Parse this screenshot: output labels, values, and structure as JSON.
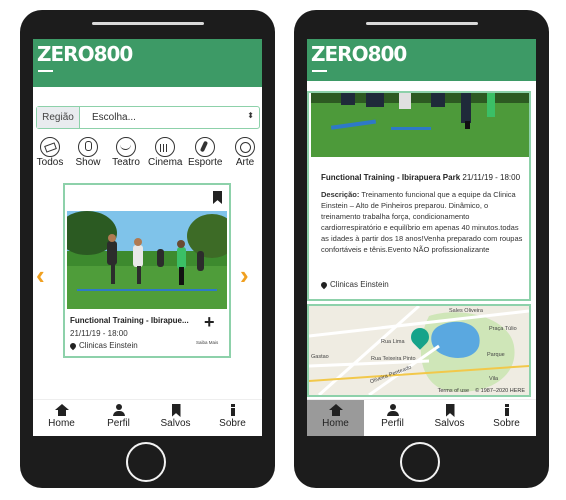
{
  "app": {
    "brand": "ZERO800"
  },
  "colors": {
    "header": "#3d9a66",
    "accent_border": "#8dd1aa",
    "arrow": "#f0a020",
    "active_nav": "#9a9a9a"
  },
  "filter": {
    "label": "Região",
    "value": "Escolha..."
  },
  "categories": [
    {
      "label": "Todos",
      "icon": "tag-icon"
    },
    {
      "label": "Show",
      "icon": "microphone-icon"
    },
    {
      "label": "Teatro",
      "icon": "theater-masks-icon"
    },
    {
      "label": "Cinema",
      "icon": "popcorn-icon"
    },
    {
      "label": "Esporte",
      "icon": "runner-icon"
    },
    {
      "label": "Arte",
      "icon": "palette-icon"
    }
  ],
  "event_card": {
    "title": "Functional Training - Ibirapue...",
    "date": "21/11/19 - 18:00",
    "location": "Clinicas Einstein",
    "more_label": "Saiba Mais"
  },
  "detail": {
    "title": "Functional Training - Ibirapuera Park",
    "date": "21/11/19 - 18:00",
    "description_label": "Descrição:",
    "description": "Treinamento funcional que a equipe da Clinica Einstein – Alto de Pinheiros preparou. Dinâmico, o treinamento trabalha força, condicionamento cardiorrespiratório e equilíbrio em apenas 40 minutos.todas as idades à partir dos 18 anos!Venha preparado com roupas confortáveis e tênis.Evento NÃO profissionalizante",
    "location": "Clinicas Einstein"
  },
  "map": {
    "terms": "Terms of use",
    "copyright": "© 1987–2020 HERE",
    "labels": [
      "Rua Lima",
      "Rua Teixeira Pinto",
      "Oliveira Penteado",
      "Sales Oliveira",
      "Praça Túlio",
      "Gastao",
      "Parque",
      "Vila"
    ]
  },
  "nav": [
    {
      "label": "Home",
      "icon": "home-icon"
    },
    {
      "label": "Perfil",
      "icon": "user-icon"
    },
    {
      "label": "Salvos",
      "icon": "bookmark-icon"
    },
    {
      "label": "Sobre",
      "icon": "info-icon"
    }
  ]
}
